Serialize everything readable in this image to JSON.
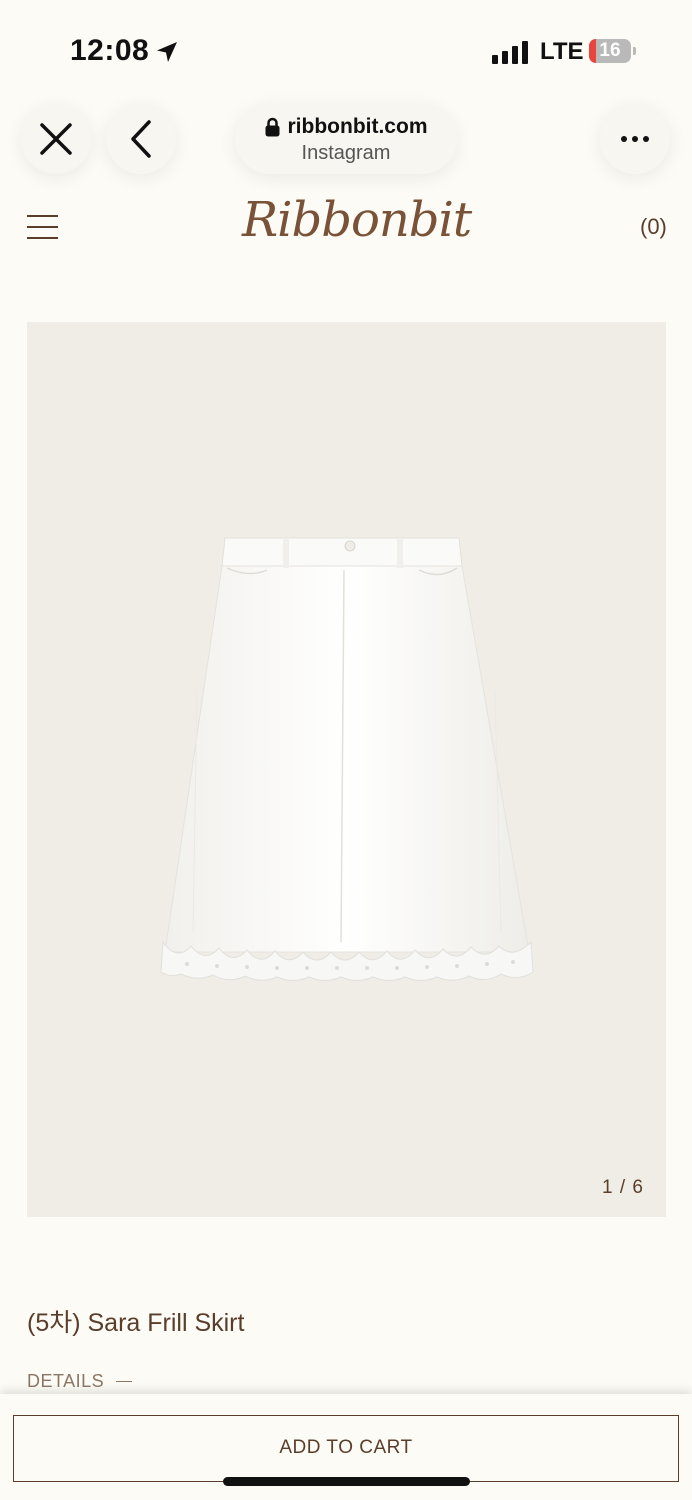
{
  "status_bar": {
    "time": "12:08",
    "network": "LTE",
    "battery_level": "16",
    "battery_fraction": 0.16,
    "battery_color": "#e8453c",
    "icons": [
      "location-arrow-icon",
      "signal-bars-icon",
      "battery-icon"
    ]
  },
  "browser": {
    "domain": "ribbonbit.com",
    "source": "Instagram",
    "icons": [
      "close-icon",
      "back-chevron-icon",
      "lock-icon",
      "more-icon"
    ]
  },
  "site_header": {
    "logo": "Ribbonbit",
    "cart_count": "(0)",
    "icons": [
      "hamburger-menu-icon"
    ]
  },
  "product": {
    "image_pager": "1 / 6",
    "title": "(5차) Sara Frill Skirt",
    "details_label": "DETAILS"
  },
  "actions": {
    "add_to_cart": "ADD TO CART"
  },
  "colors": {
    "background": "#fcfbf5",
    "brand_brown": "#5a3e2b",
    "image_background": "#efede6"
  }
}
